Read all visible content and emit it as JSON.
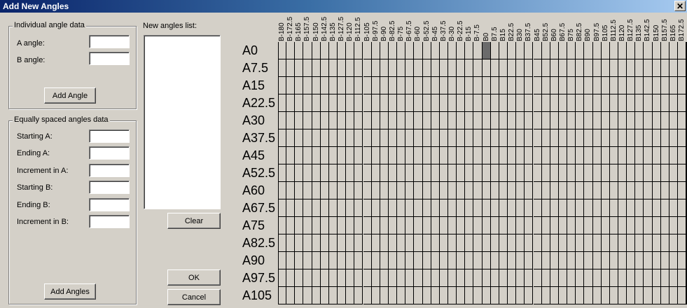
{
  "window": {
    "title": "Add New Angles",
    "close_glyph": "✕"
  },
  "individual": {
    "legend": "Individual angle data",
    "a_label": "A angle:",
    "b_label": "B angle:",
    "a_value": "",
    "b_value": "",
    "add_label": "Add Angle"
  },
  "equal": {
    "legend": "Equally spaced angles data",
    "fields": [
      {
        "label": "Starting A:",
        "value": ""
      },
      {
        "label": "Ending A:",
        "value": ""
      },
      {
        "label": "Increment in A:",
        "value": ""
      },
      {
        "label": "Starting B:",
        "value": ""
      },
      {
        "label": "Ending B:",
        "value": ""
      },
      {
        "label": "Increment in B:",
        "value": ""
      }
    ],
    "add_label": "Add Angles"
  },
  "list": {
    "label": "New angles list:",
    "clear_label": "Clear"
  },
  "dialog": {
    "ok_label": "OK",
    "cancel_label": "Cancel"
  },
  "grid": {
    "columns": [
      "B-180",
      "B-172.5",
      "B-165",
      "B-157.5",
      "B-150",
      "B-142.5",
      "B-135",
      "B-127.5",
      "B-120",
      "B-112.5",
      "B-105",
      "B-97.5",
      "B-90",
      "B-82.5",
      "B-75",
      "B-67.5",
      "B-60",
      "B-52.5",
      "B-45",
      "B-37.5",
      "B-30",
      "B-22.5",
      "B-15",
      "B-7.5",
      "B0",
      "B7.5",
      "B15",
      "B22.5",
      "B30",
      "B37.5",
      "B45",
      "B52.5",
      "B60",
      "B67.5",
      "B75",
      "B82.5",
      "B90",
      "B97.5",
      "B105",
      "B112.5",
      "B120",
      "B127.5",
      "B135",
      "B142.5",
      "B150",
      "B157.5",
      "B165",
      "B172.5",
      "B180"
    ],
    "rows": [
      "A0",
      "A7.5",
      "A15",
      "A22.5",
      "A30",
      "A37.5",
      "A45",
      "A52.5",
      "A60",
      "A67.5",
      "A75",
      "A82.5",
      "A90",
      "A97.5",
      "A105"
    ],
    "selected": [
      {
        "row": "A0",
        "col": "B0"
      }
    ]
  }
}
